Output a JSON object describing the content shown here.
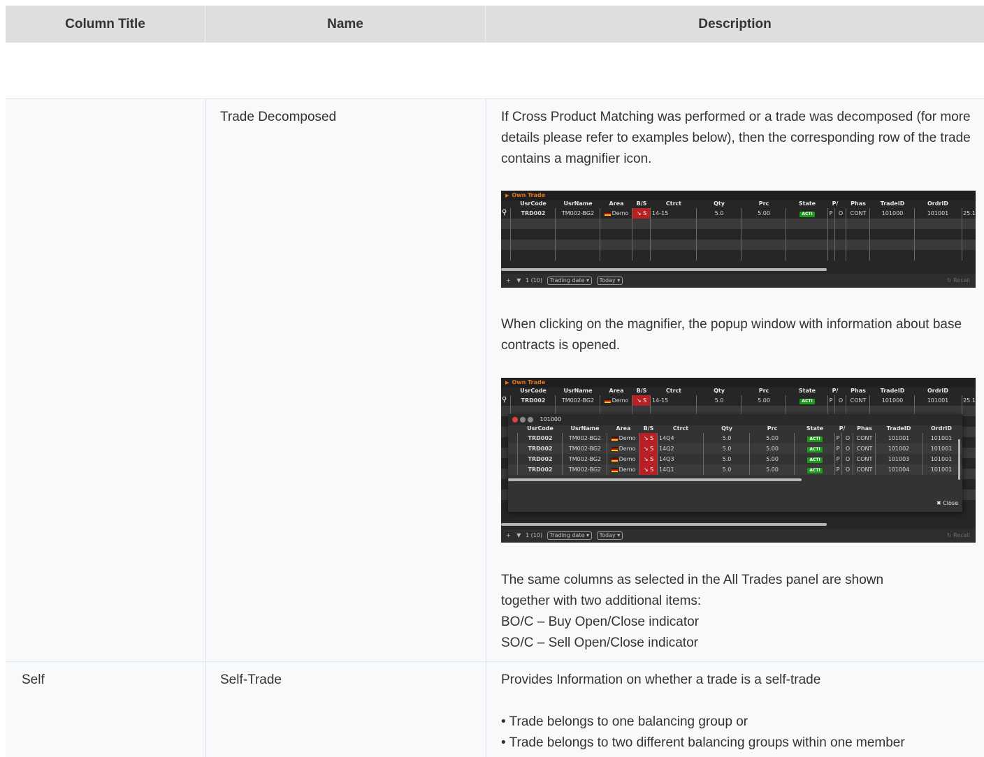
{
  "header": {
    "col1": "Column Title",
    "col2": "Name",
    "col3": "Description"
  },
  "row1": {
    "title": "",
    "name": "Trade Decomposed",
    "desc1": "If Cross Product Matching was performed or a trade was decomposed (for more details please refer to examples below), then the corresponding row of the trade contains a magnifier icon.",
    "desc2": "When clicking on the magnifier, the popup window with information about base contracts is opened.",
    "desc3_lines": [
      "The same columns as selected in the All Trades panel are shown",
      "together with two additional items:",
      "BO/C – Buy Open/Close indicator",
      "SO/C – Sell Open/Close indicator"
    ]
  },
  "row2": {
    "title": "Self",
    "name": "Self-Trade",
    "desc1": "Provides Information on whether a trade is a self-trade",
    "bullets": [
      "• Trade belongs to one balancing group or",
      "• Trade belongs to two different balancing groups within one member"
    ]
  },
  "screenshot": {
    "panel_title": "Own Trade",
    "columns": [
      "UsrCode",
      "UsrName",
      "Area",
      "B/S",
      "Ctrct",
      "Qty",
      "Prc",
      "State",
      "P/",
      "Phas",
      "TradeID",
      "OrdrID"
    ],
    "main_row": {
      "usrcode": "TRD002",
      "usrname": "TM002-BG2",
      "area": "Demo",
      "bs": "S",
      "ctrct": "14-15",
      "qty": "5.0",
      "prc": "5.00",
      "state": "ACTI",
      "p": "P",
      "o": "O",
      "phas": "CONT",
      "tradeid": "101000",
      "ordrid": "101001",
      "extra": "25.1"
    },
    "footer": {
      "plus": "+",
      "count": "1 (10)",
      "filter1": "Trading date ▾",
      "filter2": "Today ▾",
      "recall": "Recall"
    },
    "popup": {
      "title": "101000",
      "close_label": "Close",
      "rows": [
        {
          "usrcode": "TRD002",
          "usrname": "TM002-BG2",
          "area": "Demo",
          "bs": "S",
          "ctrct": "14Q4",
          "qty": "5.0",
          "prc": "5.00",
          "state": "ACTI",
          "p": "P",
          "o": "O",
          "phas": "CONT",
          "tradeid": "101001",
          "ordrid": "101001"
        },
        {
          "usrcode": "TRD002",
          "usrname": "TM002-BG2",
          "area": "Demo",
          "bs": "S",
          "ctrct": "14Q2",
          "qty": "5.0",
          "prc": "5.00",
          "state": "ACTI",
          "p": "P",
          "o": "O",
          "phas": "CONT",
          "tradeid": "101002",
          "ordrid": "101001"
        },
        {
          "usrcode": "TRD002",
          "usrname": "TM002-BG2",
          "area": "Demo",
          "bs": "S",
          "ctrct": "14Q3",
          "qty": "5.0",
          "prc": "5.00",
          "state": "ACTI",
          "p": "P",
          "o": "O",
          "phas": "CONT",
          "tradeid": "101003",
          "ordrid": "101001"
        },
        {
          "usrcode": "TRD002",
          "usrname": "TM002-BG2",
          "area": "Demo",
          "bs": "S",
          "ctrct": "14Q1",
          "qty": "5.0",
          "prc": "5.00",
          "state": "ACTI",
          "p": "P",
          "o": "O",
          "phas": "CONT",
          "tradeid": "101004",
          "ordrid": "101001"
        }
      ]
    },
    "colors": {
      "accent_orange": "#e07a16",
      "sell_red": "#b72025",
      "acti_green": "#1a9b1a"
    }
  }
}
